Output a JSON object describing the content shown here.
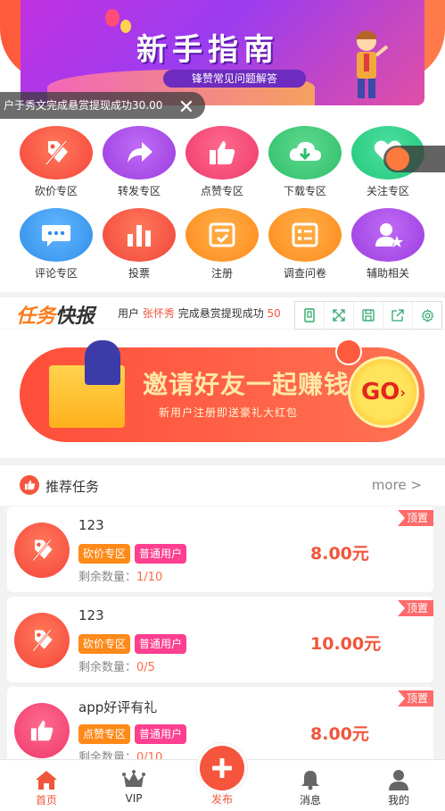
{
  "banner": {
    "title": "新手指南",
    "subtitle": "锋赞常见问题解答"
  },
  "marquee": {
    "text": "户于秀文完成悬赏提现成功30.00"
  },
  "categories": [
    {
      "label": "砍价专区",
      "icon": "tag-slash-icon",
      "color": "#f5553c"
    },
    {
      "label": "转发专区",
      "icon": "share-arrow-icon",
      "color": "#a54de8"
    },
    {
      "label": "点赞专区",
      "icon": "thumbs-up-icon",
      "color": "#f0457a"
    },
    {
      "label": "下载专区",
      "icon": "cloud-download-icon",
      "color": "#3cc77a"
    },
    {
      "label": "关注专区",
      "icon": "heart-icon",
      "color": "#2ed08a"
    },
    {
      "label": "评论专区",
      "icon": "chat-bubble-icon",
      "color": "#3a9df0"
    },
    {
      "label": "投票",
      "icon": "bar-chart-icon",
      "color": "#f5553c"
    },
    {
      "label": "注册",
      "icon": "register-form-icon",
      "color": "#ff8a1a"
    },
    {
      "label": "调查问卷",
      "icon": "survey-list-icon",
      "color": "#ff8a1a"
    },
    {
      "label": "辅助相关",
      "icon": "user-star-icon",
      "color": "#a54de8"
    }
  ],
  "news": {
    "logo_a": "任务",
    "logo_b": "快报",
    "prefix": "用户",
    "user": "张怀秀",
    "message": "完成悬赏提现成功",
    "amount": "50"
  },
  "invite": {
    "title": "邀请好友一起赚钱",
    "subtitle": "新用户注册即送豪礼大红包",
    "go": "GO"
  },
  "recommend": {
    "title": "推荐任务",
    "more": "more >"
  },
  "tasks": [
    {
      "name": "123",
      "tag1": "砍价专区",
      "tag2": "普通用户",
      "remain_label": "剩余数量：",
      "remain": "1/10",
      "price": "8.00元",
      "badge": "顶置",
      "icon": "tag-slash-icon"
    },
    {
      "name": "123",
      "tag1": "砍价专区",
      "tag2": "普通用户",
      "remain_label": "剩余数量：",
      "remain": "0/5",
      "price": "10.00元",
      "badge": "顶置",
      "icon": "tag-slash-icon"
    },
    {
      "name": "app好评有礼",
      "tag1": "点赞专区",
      "tag2": "普通用户",
      "remain_label": "剩余数量：",
      "remain": "0/10",
      "price": "8.00元",
      "badge": "顶置",
      "icon": "thumbs-up-icon"
    }
  ],
  "nav": {
    "home": "首页",
    "vip": "VIP",
    "publish": "发布",
    "messages": "消息",
    "mine": "我的"
  },
  "colors": {
    "accent": "#f0563c",
    "tag_orange": "#ff8a1a",
    "tag_pink": "#ff3f8f"
  }
}
